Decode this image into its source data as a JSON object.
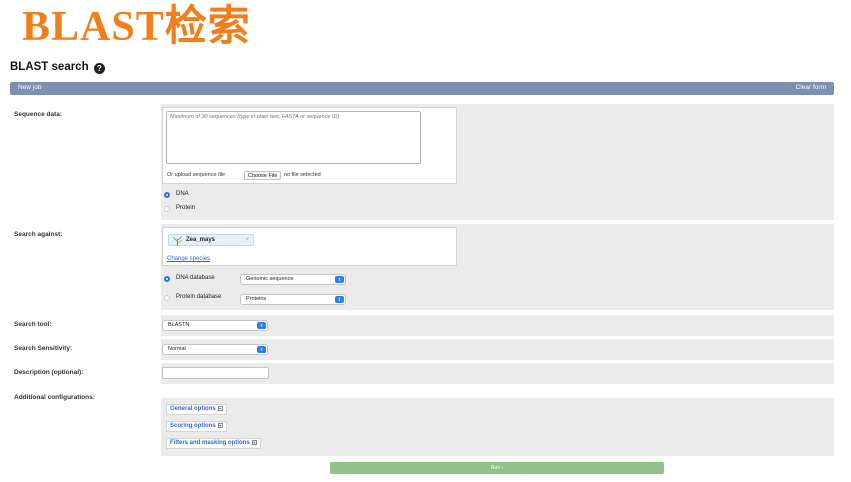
{
  "banner": "BLAST检索",
  "page": {
    "title": "BLAST search"
  },
  "job_bar": {
    "new_job": "New job",
    "clear_form": "Clear form"
  },
  "sequence": {
    "label": "Sequence data:",
    "placeholder": "Maximum of 30 sequences (type in plain text, FASTA or sequence ID)",
    "upload_label": "Or upload sequence file",
    "choose_file": "Choose File",
    "no_file": "no file selected",
    "types": [
      {
        "label": "DNA",
        "selected": true
      },
      {
        "label": "Protein",
        "selected": false
      }
    ]
  },
  "search_against": {
    "label": "Search against:",
    "species": "Zea_mays",
    "remove": "×",
    "change_species": "Change species",
    "databases": [
      {
        "label": "DNA database",
        "selected": true,
        "value": "Genomic sequence"
      },
      {
        "label": "Protein database",
        "selected": false,
        "value": "Proteins"
      }
    ]
  },
  "search_tool": {
    "label": "Search tool:",
    "value": "BLASTN"
  },
  "sensitivity": {
    "label": "Search Sensitivity:",
    "value": "Normal"
  },
  "description": {
    "label": "Description (optional):",
    "value": ""
  },
  "additional": {
    "label": "Additional configurations:",
    "options": [
      "General options",
      "Scoring options",
      "Filters and masking options"
    ]
  },
  "run_button": "Run ›",
  "colors": {
    "banner": "#f07f1b",
    "job_bar": "#7d8fb3",
    "panel": "#ebebeb",
    "run": "#94c08a",
    "select_arrow": "#2d7cf6",
    "link": "#3366cc"
  },
  "icons": {
    "help": "help-icon",
    "select": "select-arrows-icon",
    "species": "maize-plant-icon",
    "expand": "plus-box-icon"
  }
}
